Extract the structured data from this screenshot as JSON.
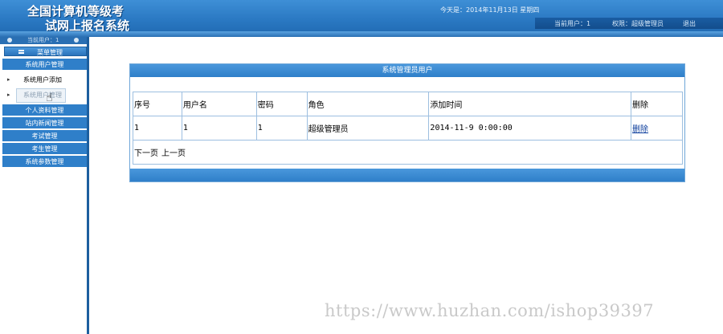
{
  "header": {
    "title_line1": "全国计算机等级考",
    "title_line2": "试网上报名系统",
    "date": "今天是：2014年11月13日 星期四",
    "current_user": "当前用户：1",
    "role": "权限：超级管理员",
    "logout": "退出"
  },
  "sidebar": {
    "current_user": "当前用户：1",
    "menu_title": "菜单管理",
    "categories": [
      "系统用户管理",
      "个人资料管理",
      "站内新闻管理",
      "考试管理",
      "考生管理",
      "系统参数管理"
    ],
    "subitems": [
      "系统用户添加",
      "系统用户管理"
    ]
  },
  "panel": {
    "title": "系统管理员用户",
    "columns": [
      "序号",
      "用户名",
      "密码",
      "角色",
      "添加时间",
      "删除"
    ],
    "rows": [
      {
        "index": "1",
        "username": "1",
        "password": "1",
        "role": "超级管理员",
        "added": "2014-11-9 0:00:00",
        "delete": "删除"
      }
    ],
    "pager": {
      "next": "下一页",
      "prev": "上一页"
    }
  },
  "watermark": "https://www.huzhan.com/ishop39397",
  "colors": {
    "accent": "#2f7fc9",
    "header": "#2a78c2",
    "border": "#9dbfe0"
  }
}
